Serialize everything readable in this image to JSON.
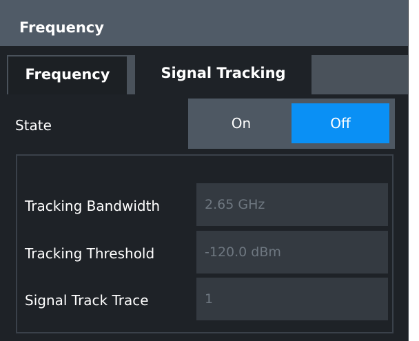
{
  "dialog": {
    "title": "Frequency"
  },
  "tabs": [
    {
      "label": "Frequency",
      "active": false
    },
    {
      "label": "Signal Tracking",
      "active": true
    }
  ],
  "state": {
    "label": "State",
    "on_label": "On",
    "off_label": "Off",
    "selected": "Off"
  },
  "fields": [
    {
      "label": "Tracking Bandwidth",
      "value": "2.65 GHz"
    },
    {
      "label": "Tracking Threshold",
      "value": "-120.0 dBm"
    },
    {
      "label": "Signal Track Trace",
      "value": "1"
    }
  ],
  "colors": {
    "accent": "#0a90f5",
    "titlebar": "#505b67",
    "background": "#1e2227"
  }
}
